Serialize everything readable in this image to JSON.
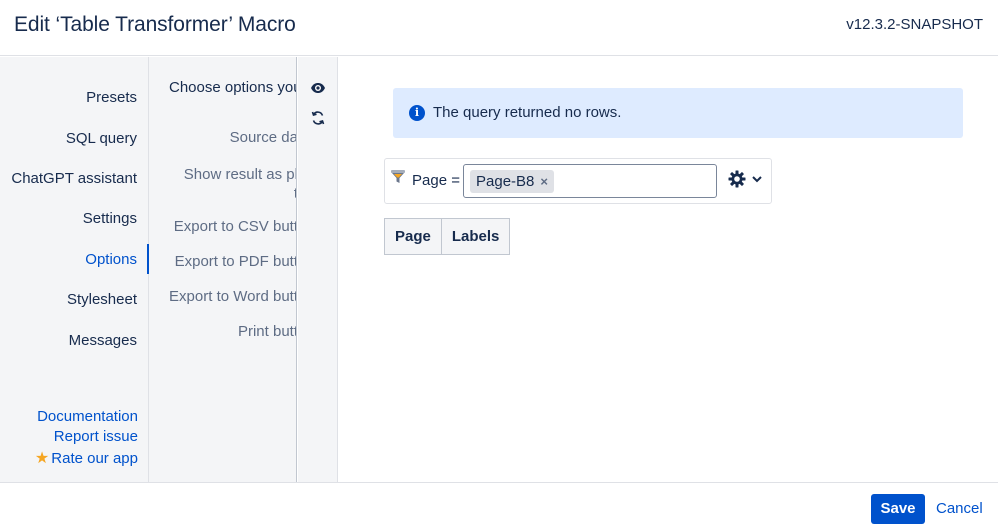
{
  "header": {
    "title": "Edit ‘Table Transformer’ Macro",
    "version": "v12.3.2-SNAPSHOT"
  },
  "nav": {
    "items": [
      {
        "label": "Presets",
        "active": false
      },
      {
        "label": "SQL query",
        "active": false
      },
      {
        "label": "ChatGPT assistant",
        "active": false
      },
      {
        "label": "Settings",
        "active": false
      },
      {
        "label": "Options",
        "active": true
      },
      {
        "label": "Stylesheet",
        "active": false
      },
      {
        "label": "Messages",
        "active": false
      }
    ],
    "links": {
      "documentation": "Documentation",
      "report_issue": "Report issue",
      "rate_app": "Rate our app"
    }
  },
  "options_panel": {
    "heading": "Choose options you",
    "labels": {
      "source_data": "Source da",
      "show_result_line1": "Show result as pl",
      "show_result_line2": "t",
      "export_csv": "Export to CSV butt",
      "export_pdf": "Export to PDF butt",
      "export_word": "Export to Word butt",
      "print": "Print butt"
    }
  },
  "toolstrip": {
    "icons": [
      "eye-icon",
      "refresh-icon"
    ]
  },
  "main": {
    "info_message": "The query returned no rows.",
    "filter": {
      "label": "Page =",
      "chip_value": "Page-B8",
      "chip_remove": "×"
    },
    "table": {
      "columns": [
        "Page",
        "Labels"
      ]
    }
  },
  "footer": {
    "save_label": "Save",
    "cancel_label": "Cancel"
  },
  "colors": {
    "accent": "#0052cc",
    "info_bg": "#deebff",
    "panel_bg": "#f4f5f7",
    "star": "#f5a623"
  }
}
